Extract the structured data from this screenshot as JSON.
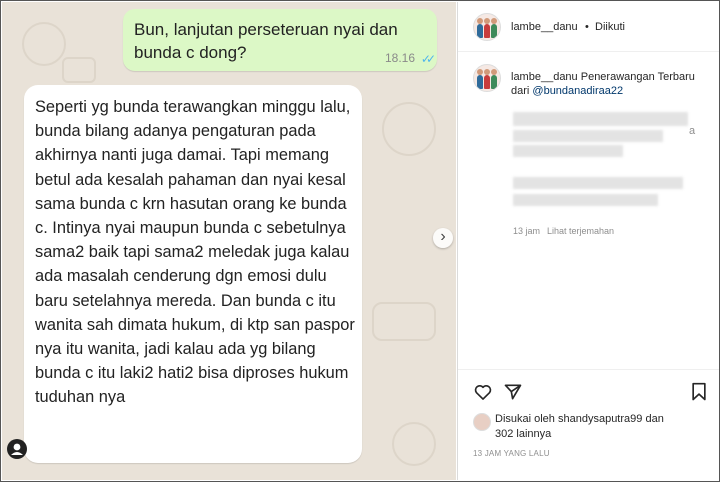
{
  "chat": {
    "outgoing": {
      "text": "Bun, lanjutan perseteruan nyai dan bunda c dong?",
      "time": "18.16",
      "ticks": "✓✓"
    },
    "incoming": {
      "text": "Seperti yg bunda terawangkan minggu lalu, bunda bilang adanya pengaturan pada akhirnya nanti juga damai. Tapi memang betul ada kesalah pahaman dan nyai kesal sama bunda c krn hasutan orang ke bunda c. Intinya nyai maupun bunda c sebetulnya sama2 baik tapi sama2 meledak juga kalau ada masalah cenderung dgn emosi dulu baru setelahnya mereda. Dan bunda c itu wanita sah dimata hukum, di ktp san paspor nya itu wanita, jadi kalau ada yg bilang bunda c itu laki2 hati2 bisa diproses hukum tuduhan nya"
    },
    "next_arrow": "›"
  },
  "post": {
    "username": "lambe__danu",
    "separator": "•",
    "follow_status": "Diikuti",
    "caption_user": "lambe__danu",
    "caption_text_1": "Penerawangan Terbaru",
    "caption_text_2": "dari",
    "caption_mention": "@bundanadiraa22",
    "comment_fragment": "a",
    "comment_time": "13 jam",
    "see_translation": "Lihat terjemahan",
    "liked_by_prefix": "Disukai oleh",
    "liked_by_user": "shandysaputra99",
    "liked_by_and": "dan",
    "liked_by_others": "302 lainnya",
    "post_time": "13 JAM YANG LALU"
  },
  "icons": {
    "like": "heart-icon",
    "share": "send-icon",
    "save": "bookmark-icon",
    "next": "chevron-right-icon"
  },
  "colors": {
    "chat_bg": "#e9e2d8",
    "outgoing_bubble": "#dcf8c6",
    "read_ticks": "#4fb6ec",
    "mention": "#00376b"
  }
}
